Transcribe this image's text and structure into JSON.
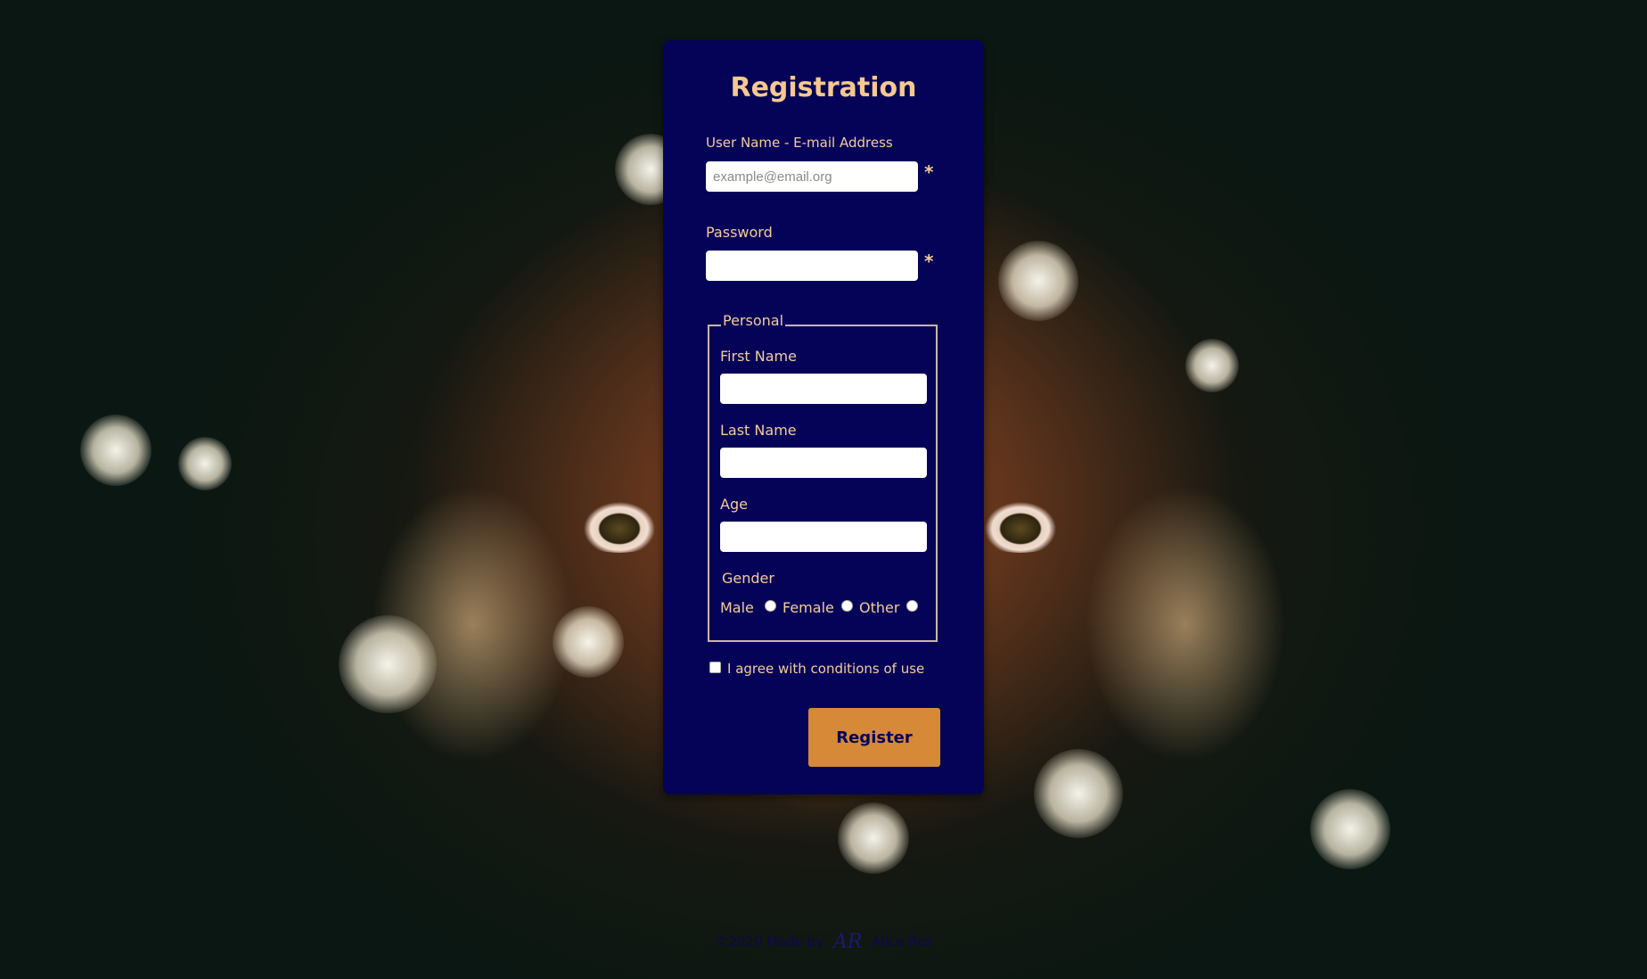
{
  "form": {
    "title": "Registration",
    "username_label": "User Name - E-mail Address",
    "username_placeholder": "example@email.org",
    "username_value": "",
    "password_label": "Password",
    "password_value": "",
    "required_mark": "*",
    "personal": {
      "legend": "Personal",
      "first_name_label": "First Name",
      "first_name_value": "",
      "last_name_label": "Last Name",
      "last_name_value": "",
      "age_label": "Age",
      "age_value": "",
      "gender_label": "Gender",
      "gender_options": [
        "Male",
        "Female",
        "Other"
      ]
    },
    "agree_label": "I agree with conditions of use",
    "agree_checked": false,
    "register_label": "Register"
  },
  "footer": {
    "copyright": "©2020 Made by",
    "signature": "AR",
    "author": "Alice Rez"
  },
  "colors": {
    "card_bg": "#050357",
    "label": "#f5cb9c",
    "title": "#f7c98f",
    "button_bg": "#d68937",
    "button_text": "#050357"
  }
}
